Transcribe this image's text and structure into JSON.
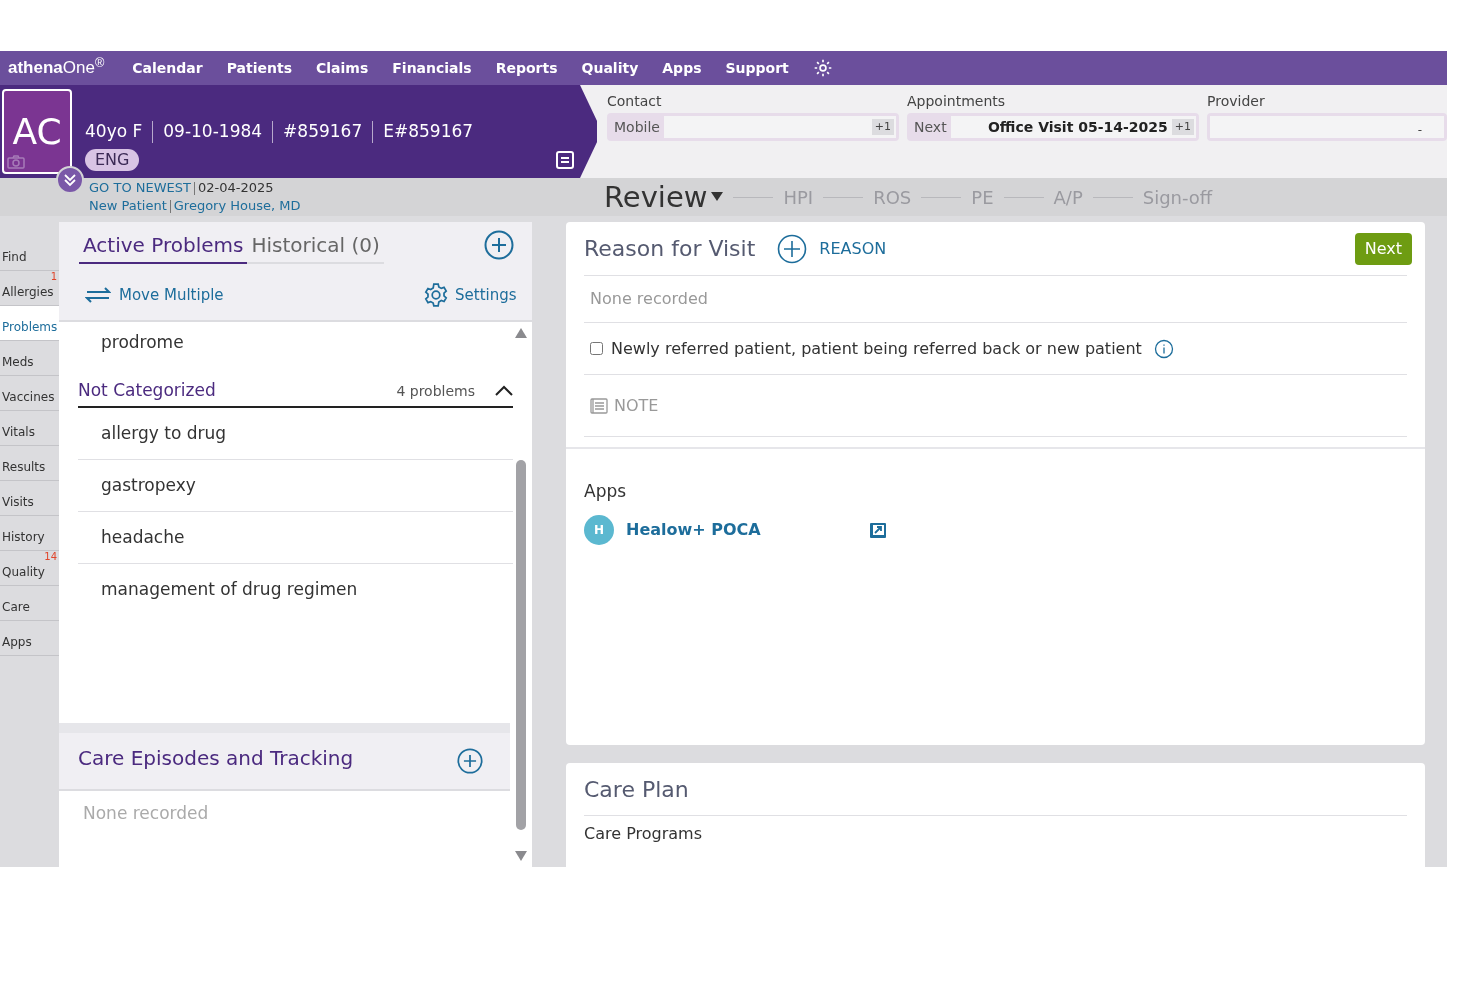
{
  "top_nav": {
    "brand": "**athena**One$^{®}$",
    "items": [
      "Calendar",
      "Patients",
      "Claims",
      "Financials",
      "Reports",
      "Quality",
      "Apps",
      "Support"
    ]
  },
  "patient": {
    "initials": "AC",
    "age_sex": "40yo F",
    "dob": "09-10-1984",
    "mrn": "#859167",
    "enterprise_id": "E#859167",
    "language": "ENG",
    "go_to_newest": "GO TO NEWEST",
    "encounter_date": "02-04-2025",
    "visit_type": "New Patient",
    "provider": "Gregory House, MD"
  },
  "contact": {
    "label": "Contact",
    "field_label": "Mobile",
    "more": "+1"
  },
  "appointments": {
    "label": "Appointments",
    "field_label": "Next",
    "value": "Office Visit 05-14-2025",
    "more": "+1"
  },
  "provider_box": {
    "label": "Provider",
    "value": "-"
  },
  "workflow": {
    "current": "Review",
    "steps": [
      "HPI",
      "ROS",
      "PE",
      "A/P",
      "Sign-off"
    ]
  },
  "side_nav": [
    {
      "label": "Find",
      "selected": false
    },
    {
      "label": "Allergies",
      "badge": "1",
      "selected": false
    },
    {
      "label": "Problems",
      "selected": true
    },
    {
      "label": "Meds",
      "selected": false
    },
    {
      "label": "Vaccines",
      "selected": false
    },
    {
      "label": "Vitals",
      "selected": false
    },
    {
      "label": "Results",
      "selected": false
    },
    {
      "label": "Visits",
      "selected": false
    },
    {
      "label": "History",
      "selected": false
    },
    {
      "label": "Quality",
      "badge": "14",
      "selected": false
    },
    {
      "label": "Care",
      "selected": false
    },
    {
      "label": "Apps",
      "selected": false
    }
  ],
  "problems_panel": {
    "tabs": [
      {
        "label": "Active Problems",
        "selected": true
      },
      {
        "label": "Historical (0)",
        "selected": false
      }
    ],
    "move_multiple": "Move Multiple",
    "settings": "Settings",
    "top_item": "prodrome",
    "group": {
      "title": "Not Categorized",
      "count": "4 problems",
      "expanded": true,
      "items": [
        "allergy to drug",
        "gastropexy",
        "headache",
        "management of drug regimen"
      ]
    },
    "care_episodes": {
      "title": "Care Episodes and Tracking",
      "empty": "None recorded"
    }
  },
  "reason_for_visit": {
    "title": "Reason for Visit",
    "add": "REASON",
    "next": "Next",
    "empty": "None recorded",
    "referral_checkbox": {
      "label": "Newly referred patient, patient being referred back or new patient",
      "checked": false
    },
    "note": "NOTE"
  },
  "apps": {
    "title": "Apps",
    "items": [
      {
        "initial": "H",
        "name": "Healow+ POCA"
      }
    ]
  },
  "care_plan": {
    "title": "Care Plan",
    "sections": [
      "Care Programs"
    ]
  }
}
